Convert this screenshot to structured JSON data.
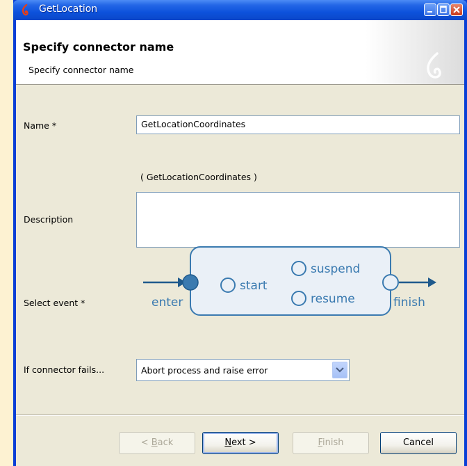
{
  "window": {
    "title": "GetLocation"
  },
  "header": {
    "title": "Specify connector name",
    "subtitle": "Specify connector name"
  },
  "form": {
    "name_label": "Name *",
    "name_value": "GetLocationCoordinates",
    "name_preview": "( GetLocationCoordinates )",
    "description_label": "Description",
    "description_value": "",
    "event_label": "Select event *",
    "fail_label": "If connector fails...",
    "fail_selected": "Abort process and raise error"
  },
  "event_diagram": {
    "enter": "enter",
    "start": "start",
    "suspend": "suspend",
    "resume": "resume",
    "finish": "finish",
    "selected": "enter"
  },
  "buttons": {
    "back": {
      "u": "B",
      "rest": "ack",
      "prefix": "< "
    },
    "next": {
      "u": "N",
      "rest": "ext >"
    },
    "finish": {
      "u": "F",
      "rest": "inish"
    },
    "cancel": "Cancel"
  },
  "colors": {
    "accent": "#3a7ab0",
    "diagram_fill": "#eaf0f7"
  }
}
